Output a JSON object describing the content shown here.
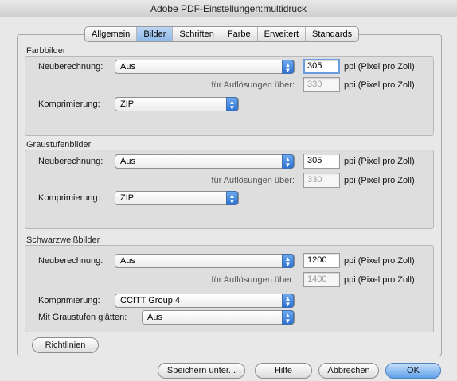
{
  "window": {
    "title": "Adobe PDF-Einstellungen:multidruck"
  },
  "tabs": [
    {
      "label": "Allgemein"
    },
    {
      "label": "Bilder"
    },
    {
      "label": "Schriften"
    },
    {
      "label": "Farbe"
    },
    {
      "label": "Erweitert"
    },
    {
      "label": "Standards"
    }
  ],
  "active_tab": "Bilder",
  "groups": {
    "color": {
      "title": "Farbbilder",
      "resample_label": "Neuberechnung:",
      "resample_value": "Aus",
      "resolution": "305",
      "resolution_unit": "ppi (Pixel pro Zoll)",
      "above_label": "für Auflösungen über:",
      "above_value": "330",
      "above_unit": "ppi (Pixel pro Zoll)",
      "compression_label": "Komprimierung:",
      "compression_value": "ZIP"
    },
    "gray": {
      "title": "Graustufenbilder",
      "resample_label": "Neuberechnung:",
      "resample_value": "Aus",
      "resolution": "305",
      "resolution_unit": "ppi (Pixel pro Zoll)",
      "above_label": "für Auflösungen über:",
      "above_value": "330",
      "above_unit": "ppi (Pixel pro Zoll)",
      "compression_label": "Komprimierung:",
      "compression_value": "ZIP"
    },
    "mono": {
      "title": "Schwarzweißbilder",
      "resample_label": "Neuberechnung:",
      "resample_value": "Aus",
      "resolution": "1200",
      "resolution_unit": "ppi (Pixel pro Zoll)",
      "above_label": "für Auflösungen über:",
      "above_value": "1400",
      "above_unit": "ppi (Pixel pro Zoll)",
      "compression_label": "Komprimierung:",
      "compression_value": "CCITT Group 4",
      "smooth_label": "Mit Graustufen glätten:",
      "smooth_value": "Aus"
    }
  },
  "buttons": {
    "policies": "Richtlinien",
    "save_as": "Speichern unter...",
    "help": "Hilfe",
    "cancel": "Abbrechen",
    "ok": "OK"
  },
  "icons": {
    "popup_arrows": "up-down-arrows-icon"
  },
  "colors": {
    "accent": "#5fa0ea",
    "focus": "#6c9ddb"
  }
}
